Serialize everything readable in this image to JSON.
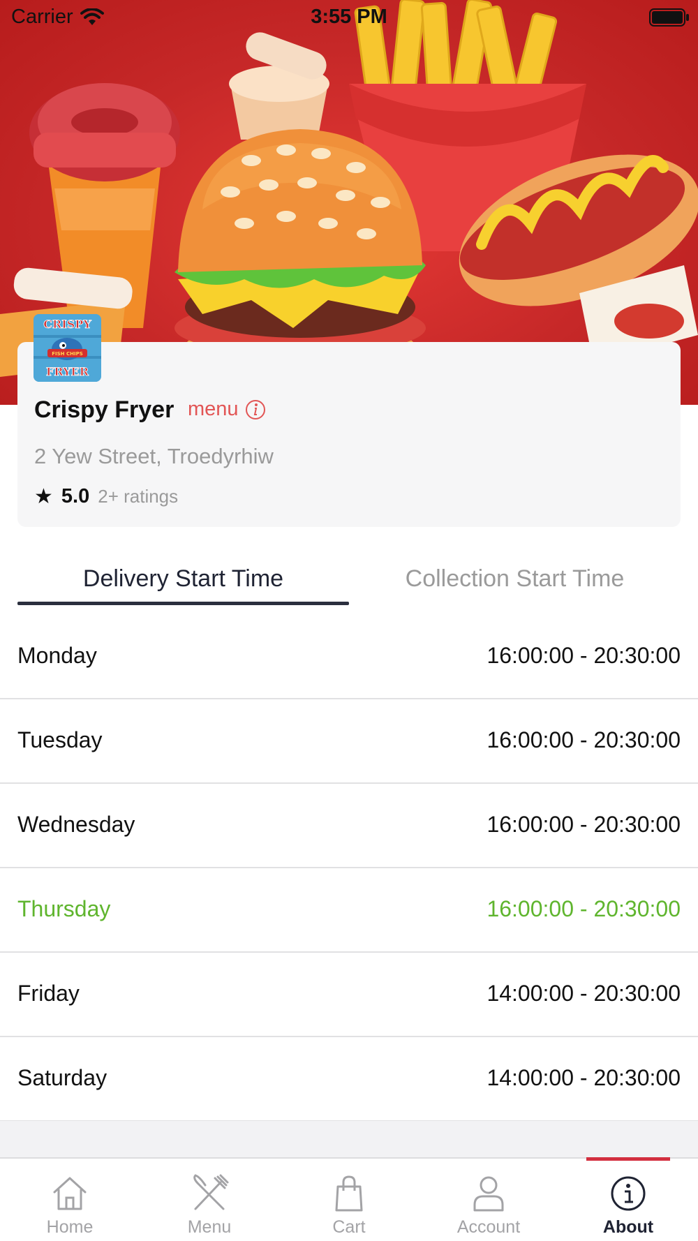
{
  "status_bar": {
    "carrier": "Carrier",
    "time": "3:55 PM"
  },
  "store": {
    "name": "Crispy Fryer",
    "menu_link": "menu",
    "address": "2 Yew Street, Troedyrhiw",
    "rating": "5.0",
    "ratings_count": "2+ ratings",
    "logo_text_top": "CRISPY",
    "logo_text_bottom": "FRYER",
    "logo_text_middle": "FISH CHIPS"
  },
  "tabs": {
    "delivery": "Delivery Start Time",
    "collection": "Collection Start Time",
    "active": "delivery"
  },
  "hours": [
    {
      "day": "Monday",
      "time": "16:00:00 - 20:30:00",
      "today": false
    },
    {
      "day": "Tuesday",
      "time": "16:00:00 - 20:30:00",
      "today": false
    },
    {
      "day": "Wednesday",
      "time": "16:00:00 - 20:30:00",
      "today": false
    },
    {
      "day": "Thursday",
      "time": "16:00:00 - 20:30:00",
      "today": true
    },
    {
      "day": "Friday",
      "time": "14:00:00 - 20:30:00",
      "today": false
    },
    {
      "day": "Saturday",
      "time": "14:00:00 - 20:30:00",
      "today": false
    }
  ],
  "nav": {
    "items": [
      {
        "label": "Home",
        "icon": "home-icon"
      },
      {
        "label": "Menu",
        "icon": "fork-knife-icon"
      },
      {
        "label": "Cart",
        "icon": "shopping-bag-icon"
      },
      {
        "label": "Account",
        "icon": "person-icon"
      },
      {
        "label": "About",
        "icon": "info-icon"
      }
    ],
    "active": "About"
  },
  "colors": {
    "brand_red": "#d32f3f",
    "menu_link": "#e25555",
    "today_green": "#5fb52e",
    "tab_active": "#1f2333",
    "muted": "#9a9a9a"
  }
}
